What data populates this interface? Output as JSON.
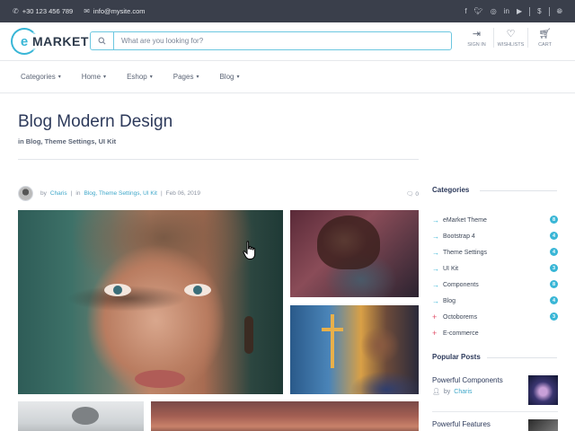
{
  "topbar": {
    "phone": "+30 123 456 789",
    "email": "info@mysite.com",
    "socials": [
      "facebook-icon",
      "twitter-icon",
      "instagram-icon",
      "linkedin-icon",
      "youtube-icon",
      "dollar-icon",
      "globe-icon"
    ]
  },
  "header": {
    "logo_text": "MARKET",
    "logo_letter": "e",
    "search_placeholder": "What are you looking for?",
    "actions": [
      {
        "label": "SIGN IN",
        "icon": "sign-in-icon"
      },
      {
        "label": "WISHLISTS",
        "icon": "heart-icon"
      },
      {
        "label": "CART",
        "icon": "cart-icon"
      }
    ]
  },
  "nav": {
    "items": [
      "Categories",
      "Home",
      "Eshop",
      "Pages",
      "Blog"
    ]
  },
  "page": {
    "title": "Blog Modern Design",
    "breadcrumb": "in Blog, Theme Settings, UI Kit"
  },
  "post": {
    "by_label": "by",
    "author": "Charis",
    "in_label": "in",
    "categories": "Blog, Theme Settings, UI Kit",
    "date": "Feb 06, 2019",
    "comments": "0"
  },
  "sidebar": {
    "categories_title": "Categories",
    "categories": [
      {
        "label": "eMarket Theme",
        "count": "8",
        "marker": "arrow"
      },
      {
        "label": "Bootstrap 4",
        "count": "4",
        "marker": "arrow"
      },
      {
        "label": "Theme Settings",
        "count": "4",
        "marker": "arrow"
      },
      {
        "label": "UI Kit",
        "count": "3",
        "marker": "arrow"
      },
      {
        "label": "Components",
        "count": "8",
        "marker": "arrow"
      },
      {
        "label": "Blog",
        "count": "4",
        "marker": "arrow"
      },
      {
        "label": "Octoborems",
        "count": "3",
        "marker": "plus"
      },
      {
        "label": "E-commerce",
        "count": "",
        "marker": "plus"
      }
    ],
    "popular_title": "Popular Posts",
    "popular": [
      {
        "title": "Powerful Components",
        "by_label": "by",
        "author": "Charis"
      },
      {
        "title": "Powerful Features"
      }
    ]
  },
  "colors": {
    "accent": "#39b6d6",
    "topbar_bg": "#3a3f4b",
    "title": "#2d3a5b",
    "plus_marker": "#e2506a"
  }
}
